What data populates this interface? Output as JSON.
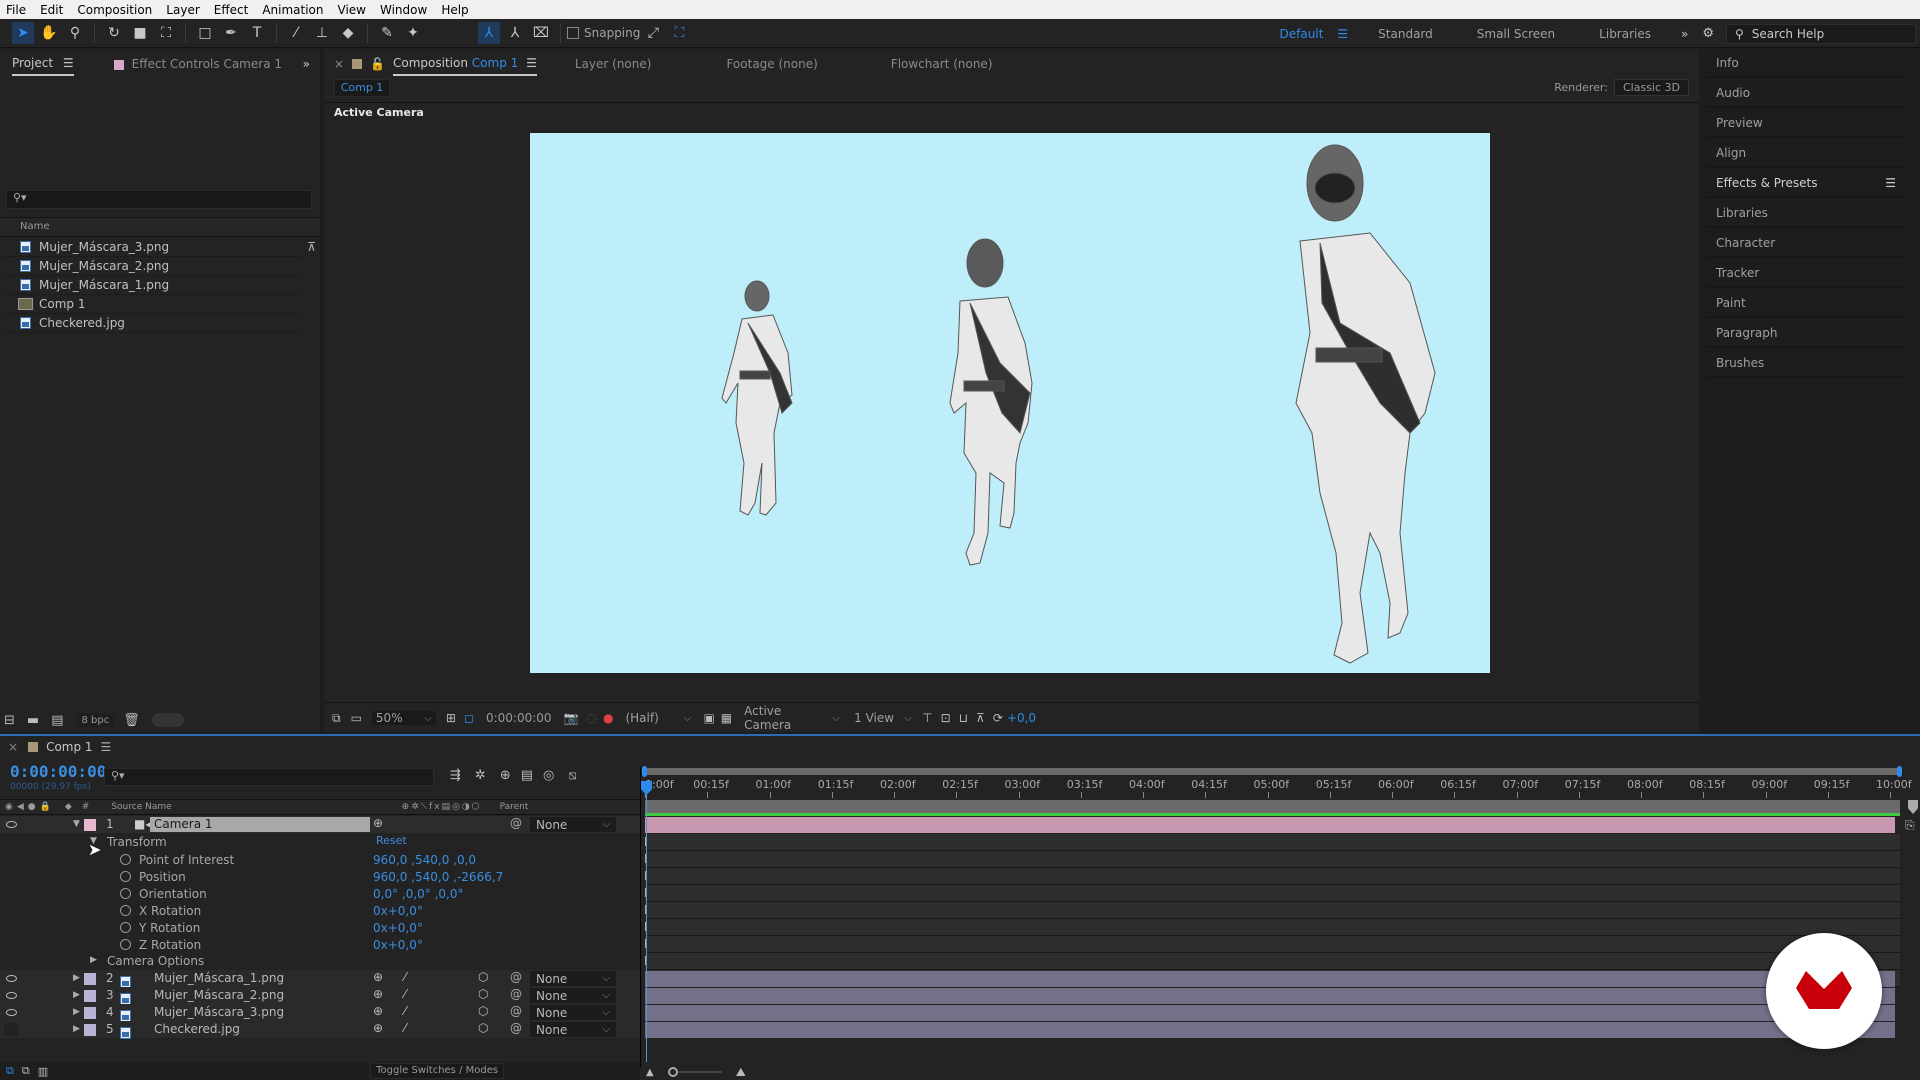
{
  "menu": [
    "File",
    "Edit",
    "Composition",
    "Layer",
    "Effect",
    "Animation",
    "View",
    "Window",
    "Help"
  ],
  "toolbar": {
    "snapping_label": "Snapping",
    "tools": [
      "selection-tool",
      "hand-tool",
      "zoom-tool",
      "rotate-tool",
      "camera-tool",
      "pan-behind-tool",
      "rectangle-tool",
      "pen-tool",
      "type-tool",
      "brush-tool",
      "clone-stamp-tool",
      "eraser-tool",
      "roto-brush-tool",
      "puppet-pin-tool"
    ]
  },
  "workspaces": {
    "items": [
      "Default",
      "Standard",
      "Small Screen",
      "Libraries"
    ],
    "active": "Default",
    "search_placeholder": "Search Help"
  },
  "project_panel": {
    "tab_project": "Project",
    "tab_effect_controls": "Effect Controls Camera 1",
    "column_name": "Name",
    "items": [
      {
        "name": "Mujer_Máscara_3.png",
        "type": "image"
      },
      {
        "name": "Mujer_Máscara_2.png",
        "type": "image"
      },
      {
        "name": "Mujer_Máscara_1.png",
        "type": "image"
      },
      {
        "name": "Comp 1",
        "type": "composition"
      },
      {
        "name": "Checkered.jpg",
        "type": "image"
      }
    ],
    "bpc": "8 bpc"
  },
  "composition_panel": {
    "tab_prefix": "Composition",
    "tab_comp": "Comp 1",
    "tab_layer": "Layer (none)",
    "tab_footage": "Footage (none)",
    "tab_flowchart": "Flowchart (none)",
    "breadcrumb": "Comp 1",
    "renderer_label": "Renderer:",
    "renderer_value": "Classic 3D",
    "view_label": "Active Camera",
    "background_color": "#bdeef9",
    "footer": {
      "zoom": "50%",
      "timecode": "0:00:00:00",
      "resolution": "(Half)",
      "camera": "Active Camera",
      "views": "1 View",
      "exposure": "+0,0"
    }
  },
  "right_panel": {
    "items": [
      "Info",
      "Audio",
      "Preview",
      "Align",
      "Effects & Presets",
      "Libraries",
      "Character",
      "Tracker",
      "Paint",
      "Paragraph",
      "Brushes"
    ],
    "active": "Effects & Presets"
  },
  "timeline": {
    "tab": "Comp 1",
    "timecode": "0:00:00:00",
    "frame_info": "00000 (29.97 fps)",
    "columns": {
      "hash": "#",
      "source_name": "Source Name",
      "parent": "Parent"
    },
    "ruler": [
      "0:00f",
      "00:15f",
      "01:00f",
      "01:15f",
      "02:00f",
      "02:15f",
      "03:00f",
      "03:15f",
      "04:00f",
      "04:15f",
      "05:00f",
      "05:15f",
      "06:00f",
      "06:15f",
      "07:00f",
      "07:15f",
      "08:00f",
      "08:15f",
      "09:00f",
      "09:15f",
      "10:00f"
    ],
    "camera_layer": {
      "index": "1",
      "name": "Camera 1",
      "parent": "None"
    },
    "transform": {
      "label": "Transform",
      "reset": "Reset",
      "properties": [
        {
          "name": "Point of Interest",
          "value": "960,0 ,540,0 ,0,0"
        },
        {
          "name": "Position",
          "value": "960,0 ,540,0 ,-2666,7"
        },
        {
          "name": "Orientation",
          "value": "0,0° ,0,0° ,0,0°"
        },
        {
          "name": "X Rotation",
          "value": "0x+0,0°"
        },
        {
          "name": "Y Rotation",
          "value": "0x+0,0°"
        },
        {
          "name": "Z Rotation",
          "value": "0x+0,0°"
        }
      ]
    },
    "camera_options": "Camera Options",
    "layers": [
      {
        "index": "2",
        "name": "Mujer_Máscara_1.png",
        "parent": "None",
        "visible": true
      },
      {
        "index": "3",
        "name": "Mujer_Máscara_2.png",
        "parent": "None",
        "visible": true
      },
      {
        "index": "4",
        "name": "Mujer_Máscara_3.png",
        "parent": "None",
        "visible": true
      },
      {
        "index": "5",
        "name": "Checkered.jpg",
        "parent": "None",
        "visible": false
      }
    ],
    "toggle_label": "Toggle Switches / Modes",
    "colors": {
      "camera_bar": "#c898b0",
      "layer_bar": "#74708a",
      "work_area": "#3ec93e",
      "accent": "#2d8ceb"
    }
  }
}
